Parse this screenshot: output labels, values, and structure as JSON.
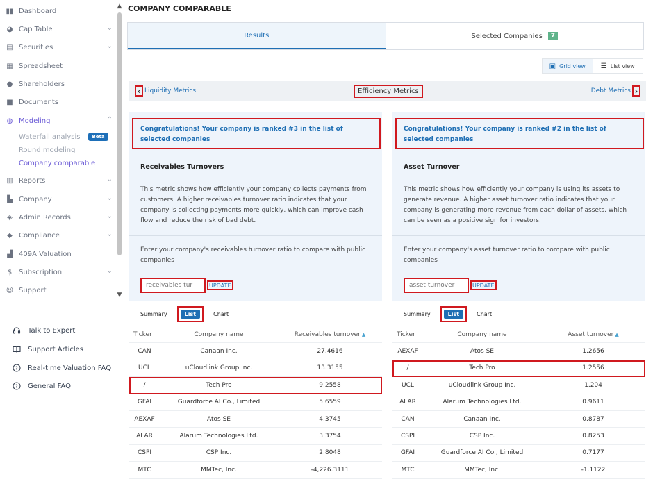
{
  "sidebar": {
    "items": [
      {
        "label": "Dashboard",
        "icon": "dashboard-icon",
        "chevron": false
      },
      {
        "label": "Cap Table",
        "icon": "pie-chart-icon",
        "chevron": true
      },
      {
        "label": "Securities",
        "icon": "clipboard-icon",
        "chevron": true
      },
      {
        "label": "Spreadsheet",
        "icon": "spreadsheet-icon",
        "chevron": false
      },
      {
        "label": "Shareholders",
        "icon": "user-icon",
        "chevron": false
      },
      {
        "label": "Documents",
        "icon": "folder-icon",
        "chevron": false
      },
      {
        "label": "Modeling",
        "icon": "lightbulb-icon",
        "chevron": true,
        "active": true
      },
      {
        "label": "Reports",
        "icon": "report-icon",
        "chevron": true
      },
      {
        "label": "Company",
        "icon": "building-icon",
        "chevron": true
      },
      {
        "label": "Admin Records",
        "icon": "records-icon",
        "chevron": true
      },
      {
        "label": "Compliance",
        "icon": "shield-check-icon",
        "chevron": true
      },
      {
        "label": "409A Valuation",
        "icon": "chart-bar-icon",
        "chevron": false
      },
      {
        "label": "Subscription",
        "icon": "dollar-icon",
        "chevron": true
      },
      {
        "label": "Support",
        "icon": "support-icon",
        "chevron": false
      }
    ],
    "modeling_sub": [
      {
        "label": "Waterfall analysis",
        "badge": "Beta"
      },
      {
        "label": "Round modeling"
      },
      {
        "label": "Company comparable",
        "active": true
      }
    ],
    "help": [
      {
        "label": "Talk to Expert",
        "icon": "headset-icon"
      },
      {
        "label": "Support Articles",
        "icon": "book-icon"
      },
      {
        "label": "Real-time Valuation FAQ",
        "icon": "question-circle-icon"
      },
      {
        "label": "General FAQ",
        "icon": "question-circle-icon"
      }
    ]
  },
  "page": {
    "title": "COMPANY COMPARABLE",
    "tabs": [
      {
        "label": "Results",
        "active": true
      },
      {
        "label": "Selected Companies",
        "count": "7"
      }
    ],
    "view": {
      "grid_label": "Grid view",
      "list_label": "List view"
    },
    "metrics_nav": {
      "prev_label": "Liquidity Metrics",
      "current_label": "Efficiency Metrics",
      "next_label": "Debt Metrics"
    }
  },
  "panels": [
    {
      "congrats": "Congratulations! Your company is ranked #3 in the list of selected companies",
      "metric_title": "Receivables Turnovers",
      "description": "This metric shows how efficiently your company collects payments from customers. A higher receivables turnover ratio indicates that your company is collecting payments more quickly, which can improve cash flow and reduce the risk of bad debt.",
      "enter_text": "Enter your company's receivables turnover ratio to compare with public companies",
      "input_placeholder": "receivables tur",
      "update_label": "UPDATE",
      "subtabs": {
        "summary": "Summary",
        "list": "List",
        "chart": "Chart"
      },
      "columns": [
        "Ticker",
        "Company name",
        "Receivables turnover"
      ],
      "rows": [
        {
          "ticker": "CAN",
          "name": "Canaan Inc.",
          "value": "27.4616"
        },
        {
          "ticker": "UCL",
          "name": "uCloudlink Group Inc.",
          "value": "13.3155"
        },
        {
          "ticker": "/",
          "name": "Tech Pro",
          "value": "9.2558",
          "highlight": true
        },
        {
          "ticker": "GFAI",
          "name": "Guardforce AI Co., Limited",
          "value": "5.6559"
        },
        {
          "ticker": "AEXAF",
          "name": "Atos SE",
          "value": "4.3745"
        },
        {
          "ticker": "ALAR",
          "name": "Alarum Technologies Ltd.",
          "value": "3.3754"
        },
        {
          "ticker": "CSPI",
          "name": "CSP Inc.",
          "value": "2.8048"
        },
        {
          "ticker": "MTC",
          "name": "MMTec, Inc.",
          "value": "-4,226.3111"
        }
      ]
    },
    {
      "congrats": "Congratulations! Your company is ranked #2 in the list of selected companies",
      "metric_title": "Asset Turnover",
      "description": "This metric shows how efficiently your company is using its assets to generate revenue. A higher asset turnover ratio indicates that your company is generating more revenue from each dollar of assets, which can be seen as a positive sign for investors.",
      "enter_text": "Enter your company's asset turnover ratio to compare with public companies",
      "input_placeholder": "asset turnover",
      "update_label": "UPDATE",
      "subtabs": {
        "summary": "Summary",
        "list": "List",
        "chart": "Chart"
      },
      "columns": [
        "Ticker",
        "Company name",
        "Asset turnover"
      ],
      "rows": [
        {
          "ticker": "AEXAF",
          "name": "Atos SE",
          "value": "1.2656"
        },
        {
          "ticker": "/",
          "name": "Tech Pro",
          "value": "1.2556",
          "highlight": true
        },
        {
          "ticker": "UCL",
          "name": "uCloudlink Group Inc.",
          "value": "1.204"
        },
        {
          "ticker": "ALAR",
          "name": "Alarum Technologies Ltd.",
          "value": "0.9611"
        },
        {
          "ticker": "CAN",
          "name": "Canaan Inc.",
          "value": "0.8787"
        },
        {
          "ticker": "CSPI",
          "name": "CSP Inc.",
          "value": "0.8253"
        },
        {
          "ticker": "GFAI",
          "name": "Guardforce AI Co., Limited",
          "value": "0.7177"
        },
        {
          "ticker": "MTC",
          "name": "MMTec, Inc.",
          "value": "-1.1122"
        }
      ]
    }
  ]
}
